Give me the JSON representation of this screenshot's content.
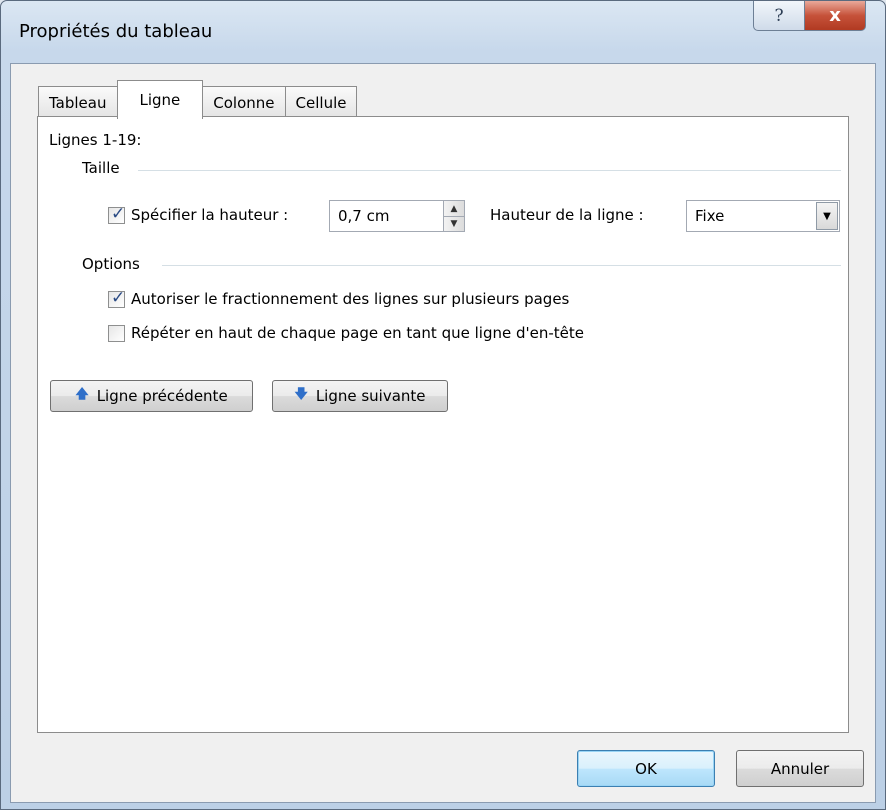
{
  "window": {
    "title": "Propriétés du tableau",
    "help_glyph": "?",
    "close_glyph": "x"
  },
  "tabs": [
    {
      "label": "Tableau",
      "active": false
    },
    {
      "label": "Ligne",
      "active": true
    },
    {
      "label": "Colonne",
      "active": false
    },
    {
      "label": "Cellule",
      "active": false
    }
  ],
  "row_panel": {
    "rows_label": "Lignes 1-19:",
    "size_group_label": "Taille",
    "specify_height": {
      "label": "Spécifier la hauteur :",
      "checked": true
    },
    "height_value": "0,7 cm",
    "row_height_label": "Hauteur de la ligne :",
    "row_height_mode": "Fixe",
    "options_group_label": "Options",
    "allow_break": {
      "label": "Autoriser le fractionnement des lignes sur plusieurs pages",
      "checked": true
    },
    "repeat_header": {
      "label": "Répéter en haut de chaque page en tant que ligne d'en-tête",
      "checked": false
    },
    "prev_row_label": "Ligne précédente",
    "next_row_label": "Ligne suivante"
  },
  "footer": {
    "ok_label": "OK",
    "cancel_label": "Annuler"
  },
  "colors": {
    "accent": "#3c7fb1",
    "close_red": "#c6523a",
    "check_mark": "#2a4a84"
  }
}
